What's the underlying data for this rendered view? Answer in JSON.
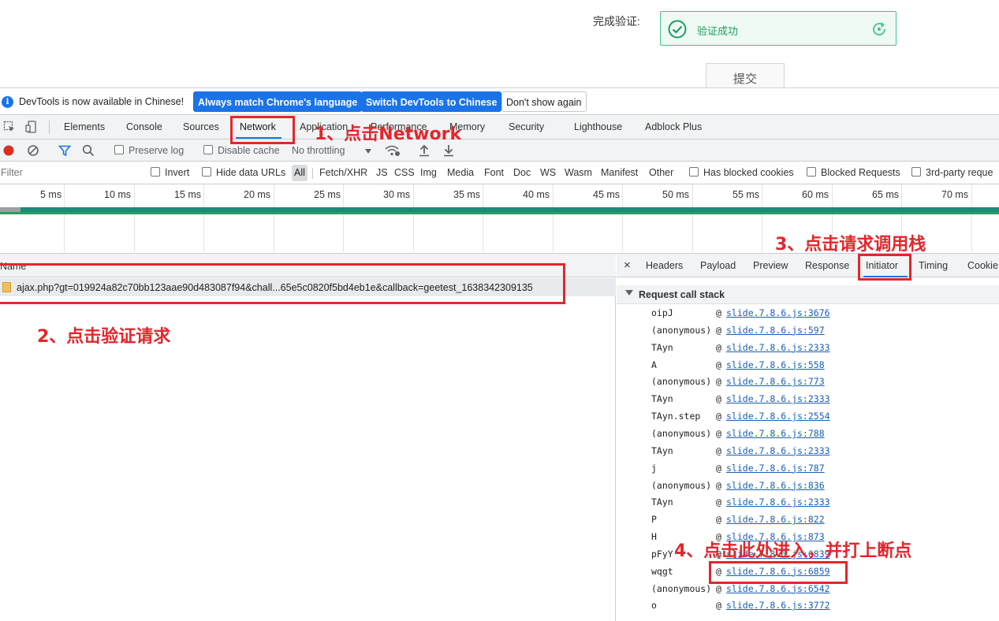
{
  "page": {
    "verify_label": "完成验证:",
    "verify_status": "验证成功",
    "submit": "提交"
  },
  "infobar": {
    "message": "DevTools is now available in Chinese!",
    "btn_match": "Always match Chrome's language",
    "btn_switch": "Switch DevTools to Chinese",
    "btn_dismiss": "Don't show again"
  },
  "tabs": [
    "Elements",
    "Console",
    "Sources",
    "Network",
    "Application",
    "Performance",
    "Memory",
    "Security",
    "Lighthouse",
    "Adblock Plus"
  ],
  "toolbar": {
    "preserve_log": "Preserve log",
    "disable_cache": "Disable cache",
    "throttling": "No throttling"
  },
  "filter": {
    "placeholder": "Filter",
    "invert": "Invert",
    "hide_data_urls": "Hide data URLs",
    "types": [
      "All",
      "Fetch/XHR",
      "JS",
      "CSS",
      "Img",
      "Media",
      "Font",
      "Doc",
      "WS",
      "Wasm",
      "Manifest",
      "Other"
    ],
    "blocked_cookies": "Has blocked cookies",
    "blocked_requests": "Blocked Requests",
    "third_party": "3rd-party reque"
  },
  "timeline": {
    "ticks": [
      "5 ms",
      "10 ms",
      "15 ms",
      "20 ms",
      "25 ms",
      "30 ms",
      "35 ms",
      "40 ms",
      "45 ms",
      "50 ms",
      "55 ms",
      "60 ms",
      "65 ms",
      "70 ms"
    ]
  },
  "requests": {
    "column_name": "Name",
    "rows": [
      {
        "name": "ajax.php?gt=019924a82c70bb123aae90d483087f94&chall...65e5c0820f5bd4eb1e&callback=geetest_1638342309135"
      }
    ]
  },
  "detail": {
    "tabs": [
      "Headers",
      "Payload",
      "Preview",
      "Response",
      "Initiator",
      "Timing",
      "Cookie"
    ],
    "section_title": "Request call stack",
    "stack": [
      {
        "fn": "oipJ",
        "loc": "slide.7.8.6.js:3676"
      },
      {
        "fn": "(anonymous)",
        "loc": "slide.7.8.6.js:597"
      },
      {
        "fn": "TAyn",
        "loc": "slide.7.8.6.js:2333"
      },
      {
        "fn": "A",
        "loc": "slide.7.8.6.js:558"
      },
      {
        "fn": "(anonymous)",
        "loc": "slide.7.8.6.js:773"
      },
      {
        "fn": "TAyn",
        "loc": "slide.7.8.6.js:2333"
      },
      {
        "fn": "TAyn.step",
        "loc": "slide.7.8.6.js:2554"
      },
      {
        "fn": "(anonymous)",
        "loc": "slide.7.8.6.js:788"
      },
      {
        "fn": "TAyn",
        "loc": "slide.7.8.6.js:2333"
      },
      {
        "fn": "j",
        "loc": "slide.7.8.6.js:787"
      },
      {
        "fn": "(anonymous)",
        "loc": "slide.7.8.6.js:836"
      },
      {
        "fn": "TAyn",
        "loc": "slide.7.8.6.js:2333"
      },
      {
        "fn": "P",
        "loc": "slide.7.8.6.js:822"
      },
      {
        "fn": "H",
        "loc": "slide.7.8.6.js:873"
      },
      {
        "fn": "pFyY",
        "loc": "slide.7.8.6.js:6839"
      },
      {
        "fn": "wqgt",
        "loc": "slide.7.8.6.js:6859"
      },
      {
        "fn": "(anonymous)",
        "loc": "slide.7.8.6.js:6542"
      },
      {
        "fn": "o",
        "loc": "slide.7.8.6.js:3772"
      }
    ]
  },
  "annotations": {
    "step1": "1、点击Network",
    "step2": "2、点击验证请求",
    "step3": "3、点击请求调用栈",
    "step4": "4、点击此处进入，并打上断点"
  },
  "colors": {
    "accent": "#1a73e8",
    "annotation": "#e3262c",
    "success": "#1e9d5e",
    "record": "#d93025"
  }
}
